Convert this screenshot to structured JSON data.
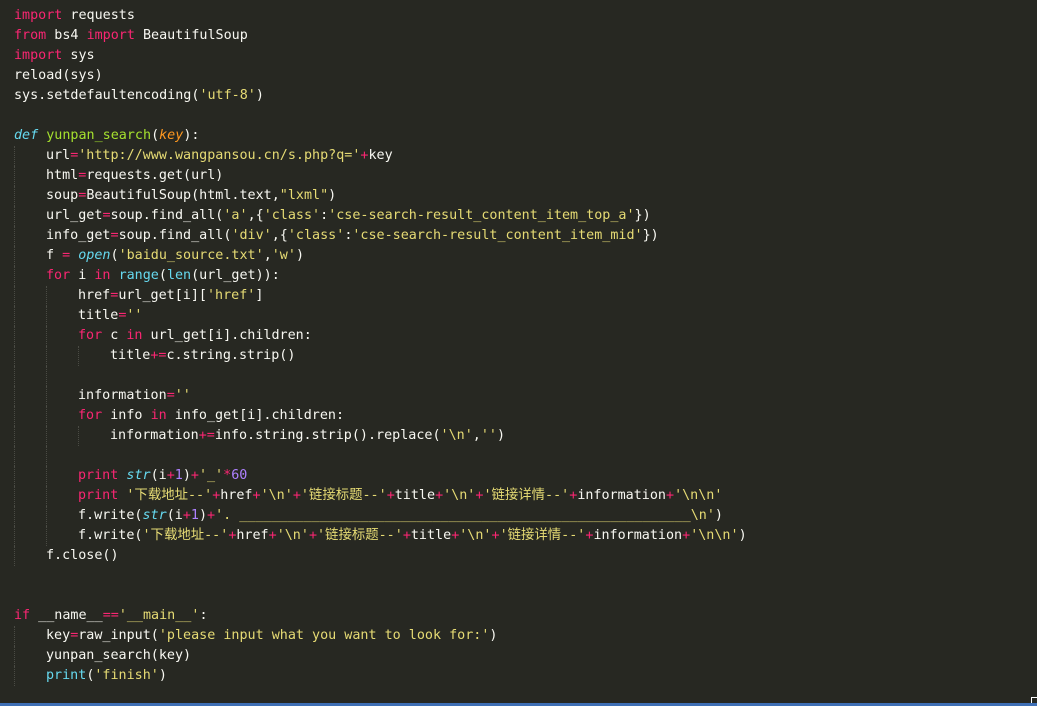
{
  "editor": {
    "colors": {
      "background": "#272822",
      "keyword": "#f92672",
      "string": "#e6db74",
      "builtin": "#66d9ef",
      "function_name": "#a6e22e",
      "parameter": "#fd971f",
      "number": "#ae81ff",
      "text": "#f8f8f2"
    },
    "lines": [
      {
        "indent": 0,
        "tokens": [
          {
            "t": "import",
            "c": "kw"
          },
          {
            "t": " requests",
            "c": "tx"
          }
        ]
      },
      {
        "indent": 0,
        "tokens": [
          {
            "t": "from",
            "c": "kw"
          },
          {
            "t": " bs4 ",
            "c": "tx"
          },
          {
            "t": "import",
            "c": "kw"
          },
          {
            "t": " BeautifulSoup",
            "c": "tx"
          }
        ]
      },
      {
        "indent": 0,
        "tokens": [
          {
            "t": "import",
            "c": "kw"
          },
          {
            "t": " sys",
            "c": "tx"
          }
        ]
      },
      {
        "indent": 0,
        "tokens": [
          {
            "t": "reload(sys)",
            "c": "tx"
          }
        ]
      },
      {
        "indent": 0,
        "tokens": [
          {
            "t": "sys.setdefaultencoding(",
            "c": "tx"
          },
          {
            "t": "'utf-8'",
            "c": "st"
          },
          {
            "t": ")",
            "c": "tx"
          }
        ]
      },
      {
        "indent": 0,
        "tokens": []
      },
      {
        "indent": 0,
        "tokens": [
          {
            "t": "def",
            "c": "bii"
          },
          {
            "t": " ",
            "c": "tx"
          },
          {
            "t": "yunpan_search",
            "c": "fn"
          },
          {
            "t": "(",
            "c": "tx"
          },
          {
            "t": "key",
            "c": "pa"
          },
          {
            "t": "):",
            "c": "tx"
          }
        ]
      },
      {
        "indent": 1,
        "tokens": [
          {
            "t": "url",
            "c": "tx"
          },
          {
            "t": "=",
            "c": "op"
          },
          {
            "t": "'http://www.wangpansou.cn/s.php?q='",
            "c": "st"
          },
          {
            "t": "+",
            "c": "op"
          },
          {
            "t": "key",
            "c": "tx"
          }
        ]
      },
      {
        "indent": 1,
        "tokens": [
          {
            "t": "html",
            "c": "tx"
          },
          {
            "t": "=",
            "c": "op"
          },
          {
            "t": "requests.get(url)",
            "c": "tx"
          }
        ]
      },
      {
        "indent": 1,
        "tokens": [
          {
            "t": "soup",
            "c": "tx"
          },
          {
            "t": "=",
            "c": "op"
          },
          {
            "t": "BeautifulSoup(html.text,",
            "c": "tx"
          },
          {
            "t": "\"lxml\"",
            "c": "st"
          },
          {
            "t": ")",
            "c": "tx"
          }
        ]
      },
      {
        "indent": 1,
        "tokens": [
          {
            "t": "url_get",
            "c": "tx"
          },
          {
            "t": "=",
            "c": "op"
          },
          {
            "t": "soup.find_all(",
            "c": "tx"
          },
          {
            "t": "'a'",
            "c": "st"
          },
          {
            "t": ",{",
            "c": "tx"
          },
          {
            "t": "'class'",
            "c": "st"
          },
          {
            "t": ":",
            "c": "tx"
          },
          {
            "t": "'cse-search-result_content_item_top_a'",
            "c": "st"
          },
          {
            "t": "})",
            "c": "tx"
          }
        ]
      },
      {
        "indent": 1,
        "tokens": [
          {
            "t": "info_get",
            "c": "tx"
          },
          {
            "t": "=",
            "c": "op"
          },
          {
            "t": "soup.find_all(",
            "c": "tx"
          },
          {
            "t": "'div'",
            "c": "st"
          },
          {
            "t": ",{",
            "c": "tx"
          },
          {
            "t": "'class'",
            "c": "st"
          },
          {
            "t": ":",
            "c": "tx"
          },
          {
            "t": "'cse-search-result_content_item_mid'",
            "c": "st"
          },
          {
            "t": "})",
            "c": "tx"
          }
        ]
      },
      {
        "indent": 1,
        "tokens": [
          {
            "t": "f ",
            "c": "tx"
          },
          {
            "t": "=",
            "c": "op"
          },
          {
            "t": " ",
            "c": "tx"
          },
          {
            "t": "open",
            "c": "bii"
          },
          {
            "t": "(",
            "c": "tx"
          },
          {
            "t": "'baidu_source.txt'",
            "c": "st"
          },
          {
            "t": ",",
            "c": "tx"
          },
          {
            "t": "'w'",
            "c": "st"
          },
          {
            "t": ")",
            "c": "tx"
          }
        ]
      },
      {
        "indent": 1,
        "tokens": [
          {
            "t": "for",
            "c": "kw"
          },
          {
            "t": " i ",
            "c": "tx"
          },
          {
            "t": "in",
            "c": "kw"
          },
          {
            "t": " ",
            "c": "tx"
          },
          {
            "t": "range",
            "c": "bi"
          },
          {
            "t": "(",
            "c": "tx"
          },
          {
            "t": "len",
            "c": "bi"
          },
          {
            "t": "(url_get)):",
            "c": "tx"
          }
        ]
      },
      {
        "indent": 2,
        "tokens": [
          {
            "t": "href",
            "c": "tx"
          },
          {
            "t": "=",
            "c": "op"
          },
          {
            "t": "url_get[i][",
            "c": "tx"
          },
          {
            "t": "'href'",
            "c": "st"
          },
          {
            "t": "]",
            "c": "tx"
          }
        ]
      },
      {
        "indent": 2,
        "tokens": [
          {
            "t": "title",
            "c": "tx"
          },
          {
            "t": "=",
            "c": "op"
          },
          {
            "t": "''",
            "c": "st"
          }
        ]
      },
      {
        "indent": 2,
        "tokens": [
          {
            "t": "for",
            "c": "kw"
          },
          {
            "t": " c ",
            "c": "tx"
          },
          {
            "t": "in",
            "c": "kw"
          },
          {
            "t": " url_get[i].children:",
            "c": "tx"
          }
        ]
      },
      {
        "indent": 3,
        "tokens": [
          {
            "t": "title",
            "c": "tx"
          },
          {
            "t": "+=",
            "c": "op"
          },
          {
            "t": "c.string.strip()",
            "c": "tx"
          }
        ]
      },
      {
        "indent": 2,
        "tokens": []
      },
      {
        "indent": 2,
        "tokens": [
          {
            "t": "information",
            "c": "tx"
          },
          {
            "t": "=",
            "c": "op"
          },
          {
            "t": "''",
            "c": "st"
          }
        ]
      },
      {
        "indent": 2,
        "tokens": [
          {
            "t": "for",
            "c": "kw"
          },
          {
            "t": " info ",
            "c": "tx"
          },
          {
            "t": "in",
            "c": "kw"
          },
          {
            "t": " info_get[i].children:",
            "c": "tx"
          }
        ]
      },
      {
        "indent": 3,
        "tokens": [
          {
            "t": "information",
            "c": "tx"
          },
          {
            "t": "+=",
            "c": "op"
          },
          {
            "t": "info.string.strip().replace(",
            "c": "tx"
          },
          {
            "t": "'\\n'",
            "c": "st"
          },
          {
            "t": ",",
            "c": "tx"
          },
          {
            "t": "''",
            "c": "st"
          },
          {
            "t": ")",
            "c": "tx"
          }
        ]
      },
      {
        "indent": 2,
        "tokens": []
      },
      {
        "indent": 2,
        "tokens": [
          {
            "t": "print",
            "c": "kw"
          },
          {
            "t": " ",
            "c": "tx"
          },
          {
            "t": "str",
            "c": "bii"
          },
          {
            "t": "(i",
            "c": "tx"
          },
          {
            "t": "+",
            "c": "op"
          },
          {
            "t": "1",
            "c": "nu"
          },
          {
            "t": ")",
            "c": "tx"
          },
          {
            "t": "+",
            "c": "op"
          },
          {
            "t": "'_'",
            "c": "st"
          },
          {
            "t": "*",
            "c": "op"
          },
          {
            "t": "60",
            "c": "nu"
          }
        ]
      },
      {
        "indent": 2,
        "tokens": [
          {
            "t": "print",
            "c": "kw"
          },
          {
            "t": " ",
            "c": "tx"
          },
          {
            "t": "'下载地址--'",
            "c": "st"
          },
          {
            "t": "+",
            "c": "op"
          },
          {
            "t": "href",
            "c": "tx"
          },
          {
            "t": "+",
            "c": "op"
          },
          {
            "t": "'\\n'",
            "c": "st"
          },
          {
            "t": "+",
            "c": "op"
          },
          {
            "t": "'链接标题--'",
            "c": "st"
          },
          {
            "t": "+",
            "c": "op"
          },
          {
            "t": "title",
            "c": "tx"
          },
          {
            "t": "+",
            "c": "op"
          },
          {
            "t": "'\\n'",
            "c": "st"
          },
          {
            "t": "+",
            "c": "op"
          },
          {
            "t": "'链接详情--'",
            "c": "st"
          },
          {
            "t": "+",
            "c": "op"
          },
          {
            "t": "information",
            "c": "tx"
          },
          {
            "t": "+",
            "c": "op"
          },
          {
            "t": "'\\n\\n'",
            "c": "st"
          }
        ]
      },
      {
        "indent": 2,
        "tokens": [
          {
            "t": "f.write(",
            "c": "tx"
          },
          {
            "t": "str",
            "c": "bii"
          },
          {
            "t": "(i",
            "c": "tx"
          },
          {
            "t": "+",
            "c": "op"
          },
          {
            "t": "1",
            "c": "nu"
          },
          {
            "t": ")",
            "c": "tx"
          },
          {
            "t": "+",
            "c": "op"
          },
          {
            "t": "'. ________________________________________________________\\n'",
            "c": "st"
          },
          {
            "t": ")",
            "c": "tx"
          }
        ]
      },
      {
        "indent": 2,
        "tokens": [
          {
            "t": "f.write(",
            "c": "tx"
          },
          {
            "t": "'下载地址--'",
            "c": "st"
          },
          {
            "t": "+",
            "c": "op"
          },
          {
            "t": "href",
            "c": "tx"
          },
          {
            "t": "+",
            "c": "op"
          },
          {
            "t": "'\\n'",
            "c": "st"
          },
          {
            "t": "+",
            "c": "op"
          },
          {
            "t": "'链接标题--'",
            "c": "st"
          },
          {
            "t": "+",
            "c": "op"
          },
          {
            "t": "title",
            "c": "tx"
          },
          {
            "t": "+",
            "c": "op"
          },
          {
            "t": "'\\n'",
            "c": "st"
          },
          {
            "t": "+",
            "c": "op"
          },
          {
            "t": "'链接详情--'",
            "c": "st"
          },
          {
            "t": "+",
            "c": "op"
          },
          {
            "t": "information",
            "c": "tx"
          },
          {
            "t": "+",
            "c": "op"
          },
          {
            "t": "'\\n\\n'",
            "c": "st"
          },
          {
            "t": ")",
            "c": "tx"
          }
        ]
      },
      {
        "indent": 1,
        "tokens": [
          {
            "t": "f.close()",
            "c": "tx"
          }
        ]
      },
      {
        "indent": 0,
        "tokens": []
      },
      {
        "indent": 0,
        "tokens": []
      },
      {
        "indent": 0,
        "tokens": [
          {
            "t": "if",
            "c": "kw"
          },
          {
            "t": " __name__",
            "c": "tx"
          },
          {
            "t": "==",
            "c": "op"
          },
          {
            "t": "'__main__'",
            "c": "st"
          },
          {
            "t": ":",
            "c": "tx"
          }
        ]
      },
      {
        "indent": 1,
        "tokens": [
          {
            "t": "key",
            "c": "tx"
          },
          {
            "t": "=",
            "c": "op"
          },
          {
            "t": "raw_input(",
            "c": "tx"
          },
          {
            "t": "'please input what you want to look for:'",
            "c": "st"
          },
          {
            "t": ")",
            "c": "tx"
          }
        ]
      },
      {
        "indent": 1,
        "tokens": [
          {
            "t": "yunpan_search(key)",
            "c": "tx"
          }
        ]
      },
      {
        "indent": 1,
        "tokens": [
          {
            "t": "print",
            "c": "bi"
          },
          {
            "t": "(",
            "c": "tx"
          },
          {
            "t": "'finish'",
            "c": "st"
          },
          {
            "t": ")",
            "c": "tx"
          }
        ]
      }
    ]
  }
}
